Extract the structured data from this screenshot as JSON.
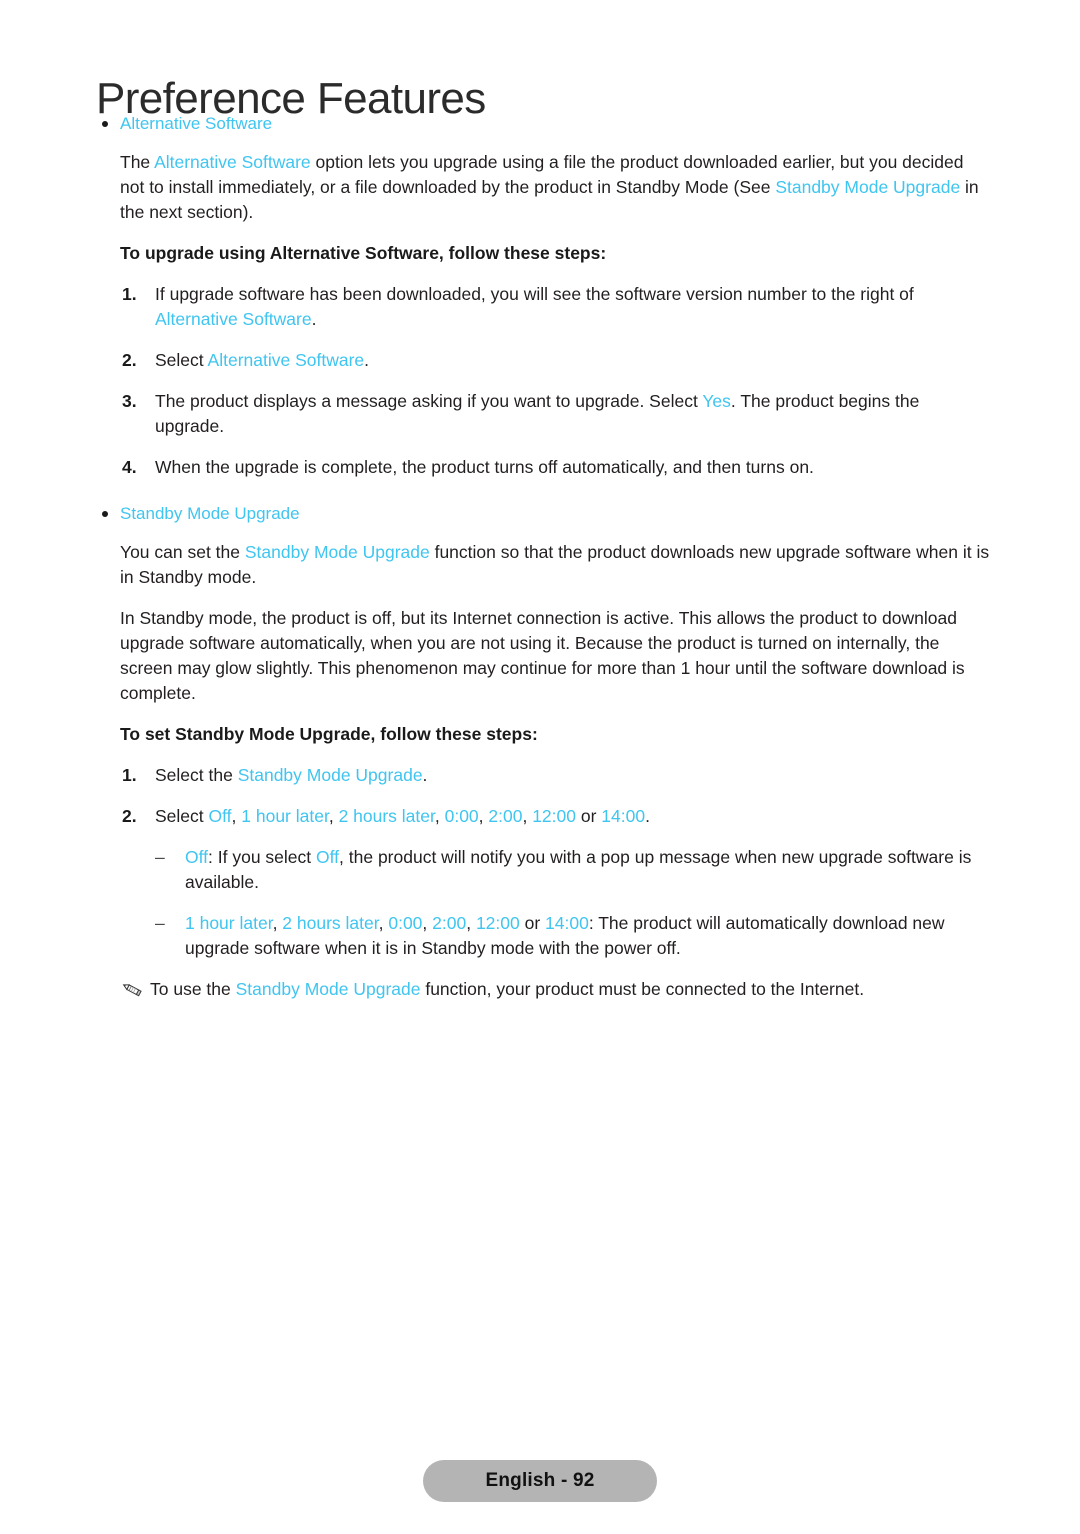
{
  "document": {
    "title": "Preference Features",
    "accent_color": "#3fc5f0",
    "text_color": "#231f20"
  },
  "sections": {
    "alternative_software": {
      "bullet_label": "Alternative Software",
      "intro": {
        "p1": "The ",
        "link1": "Alternative Software",
        "p2": " option lets you upgrade using a file the product downloaded earlier, but you decided not to install immediately, or a file downloaded by the product in Standby Mode (See ",
        "link2": "Standby Mode Upgrade",
        "p3": " in the next section)."
      },
      "steps_heading": "To upgrade using Alternative Software, follow these steps:",
      "steps": [
        {
          "num": "1.",
          "t1": "If upgrade software has been downloaded, you will see the software version number to the right of ",
          "link1": "Alternative Software",
          "t2": "."
        },
        {
          "num": "2.",
          "t1": "Select ",
          "link1": "Alternative Software",
          "t2": "."
        },
        {
          "num": "3.",
          "t1": "The product displays a message asking if you want to upgrade. Select ",
          "link1": "Yes",
          "t2": ". The product begins the upgrade."
        },
        {
          "num": "4.",
          "t1": "When the upgrade is complete, the product turns off automatically, and then turns on.",
          "link1": "",
          "t2": ""
        }
      ]
    },
    "standby_mode_upgrade": {
      "bullet_label": "Standby Mode Upgrade",
      "intro": {
        "p1": "You can set the ",
        "link1": "Standby Mode Upgrade",
        "p2": " function so that the product downloads new upgrade software when it is in Standby mode."
      },
      "explanation": "In Standby mode, the product is off, but its Internet connection is active. This allows the product to download upgrade software automatically, when you are not using it. Because the product is turned on internally, the screen may glow slightly. This phenomenon may continue for more than 1 hour until the software download is complete.",
      "steps_heading": "To set Standby Mode Upgrade, follow these steps:",
      "step1": {
        "num": "1.",
        "t1": "Select the ",
        "link1": "Standby Mode Upgrade",
        "t2": "."
      },
      "step2": {
        "num": "2.",
        "t1": "Select ",
        "o1": "Off",
        "c1": ", ",
        "o2": "1 hour later",
        "c2": ", ",
        "o3": "2 hours later",
        "c3": ", ",
        "o4": "0:00",
        "c4": ", ",
        "o5": "2:00",
        "c5": ", ",
        "o6": "12:00",
        "c6": " or ",
        "o7": "14:00",
        "c7": "."
      },
      "subitems": [
        {
          "dash": "–",
          "link1": "Off",
          "t1": ": If you select ",
          "link2": "Off",
          "t2": ", the product will notify you with a pop up message when new upgrade software is available."
        }
      ],
      "subitem2": {
        "dash": "–",
        "o1": "1 hour later",
        "c1": ", ",
        "o2": "2 hours later",
        "c2": ", ",
        "o3": "0:00",
        "c3": ", ",
        "o4": "2:00",
        "c4": ", ",
        "o5": "12:00",
        "c5": " or ",
        "o6": "14:00",
        "tail": ": The product will automatically download new upgrade software when it is in Standby mode with the power off."
      },
      "note": {
        "t1": "To use the ",
        "link1": "Standby Mode Upgrade",
        "t2": " function, your product must be connected to the Internet."
      }
    }
  },
  "footer": {
    "label": "English - 92"
  }
}
